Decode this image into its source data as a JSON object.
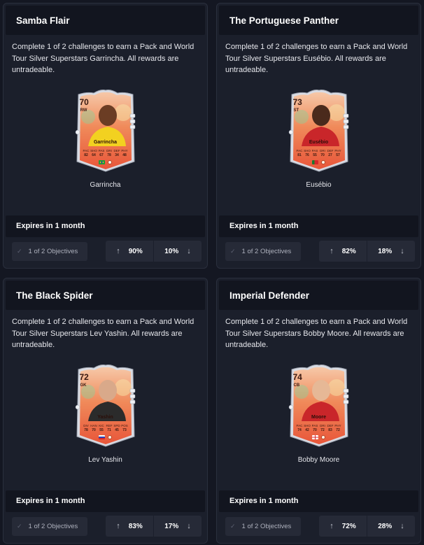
{
  "colors": {
    "background": "#141722",
    "card": "#1b1f2b",
    "header": "#12151f",
    "chip": "#262a37"
  },
  "cards": [
    {
      "title": "Samba Flair",
      "description": "Complete 1 of 2 challenges to earn a Pack and World Tour Silver Superstars Garrincha. All rewards are untradeable.",
      "player": {
        "rating": "70",
        "position": "RW",
        "name": "Garrincha",
        "stat_labels": [
          "PAC",
          "SHO",
          "PAS",
          "DRI",
          "DEF",
          "PHY"
        ],
        "stat_values": [
          "82",
          "64",
          "67",
          "78",
          "34",
          "48"
        ],
        "nation": "brazil"
      },
      "player_name": "Garrincha",
      "expires": "Expires in 1 month",
      "objectives": "1 of 2 Objectives",
      "vote_up": "90%",
      "vote_down": "10%"
    },
    {
      "title": "The Portuguese Panther",
      "description": "Complete 1 of 2 challenges to earn a Pack and World Tour Silver Superstars Eusébio. All rewards are untradeable.",
      "player": {
        "rating": "73",
        "position": "ST",
        "name": "Eusébio",
        "stat_labels": [
          "PAC",
          "SHO",
          "PAS",
          "DRI",
          "DEF",
          "PHY"
        ],
        "stat_values": [
          "81",
          "76",
          "55",
          "70",
          "27",
          "57"
        ],
        "nation": "portugal"
      },
      "player_name": "Eusébio",
      "expires": "Expires in 1 month",
      "objectives": "1 of 2 Objectives",
      "vote_up": "82%",
      "vote_down": "18%"
    },
    {
      "title": "The Black Spider",
      "description": "Complete 1 of 2 challenges to earn a Pack and World Tour Silver Superstars Lev Yashin. All rewards are untradeable.",
      "player": {
        "rating": "72",
        "position": "GK",
        "name": "Yashin",
        "stat_labels": [
          "DIV",
          "HAN",
          "KIC",
          "REF",
          "SPD",
          "POS"
        ],
        "stat_values": [
          "78",
          "70",
          "55",
          "71",
          "45",
          "73"
        ],
        "nation": "russia"
      },
      "player_name": "Lev Yashin",
      "expires": "Expires in 1 month",
      "objectives": "1 of 2 Objectives",
      "vote_up": "83%",
      "vote_down": "17%"
    },
    {
      "title": "Imperial Defender",
      "description": "Complete 1 of 2 challenges to earn a Pack and World Tour Silver Superstars Bobby Moore. All rewards are untradeable.",
      "player": {
        "rating": "74",
        "position": "CB",
        "name": "Moore",
        "stat_labels": [
          "PAC",
          "SHO",
          "PAS",
          "DRI",
          "DEF",
          "PHY"
        ],
        "stat_values": [
          "74",
          "42",
          "70",
          "72",
          "83",
          "72"
        ],
        "nation": "england"
      },
      "player_name": "Bobby Moore",
      "expires": "Expires in 1 month",
      "objectives": "1 of 2 Objectives",
      "vote_up": "72%",
      "vote_down": "28%"
    }
  ]
}
